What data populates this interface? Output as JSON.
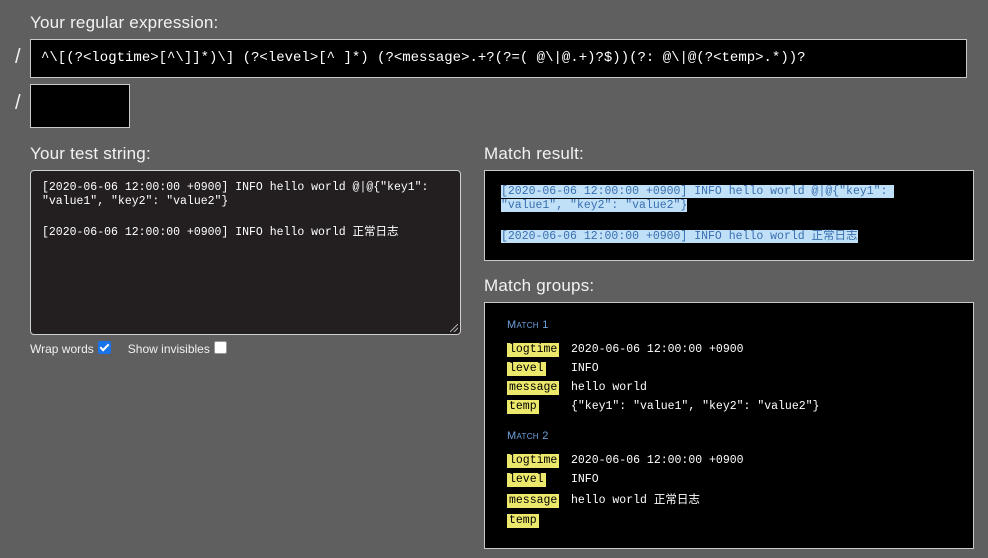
{
  "labels": {
    "regex_heading": "Your regular expression:",
    "test_heading": "Your test string:",
    "result_heading": "Match result:",
    "groups_heading": "Match groups:",
    "slash": "/"
  },
  "regex": {
    "value": "^\\[(?<logtime>[^\\]]*)\\] (?<level>[^ ]*) (?<message>.+?(?=( @\\|@.+)?$))(?: @\\|@(?<temp>.*))?",
    "flags": ""
  },
  "test_string": {
    "lines": [
      "[2020-06-06 12:00:00 +0900] INFO hello world @|@{\"key1\": \"value1\", \"key2\": \"value2\"}",
      "[2020-06-06 12:00:00 +0900] INFO hello world 正常日志"
    ]
  },
  "options": {
    "wrap_words": "Wrap words",
    "wrap_words_checked": true,
    "show_invisibles": "Show invisibles",
    "show_invisibles_checked": false
  },
  "result": {
    "lines": [
      "[2020-06-06 12:00:00 +0900] INFO hello world @|@{\"key1\": \"value1\", \"key2\": \"value2\"}",
      "[2020-06-06 12:00:00 +0900] INFO hello world 正常日志"
    ],
    "highlight_color": "#bfe0f7"
  },
  "matches": [
    {
      "title": "Match 1",
      "groups": [
        {
          "name": "logtime",
          "value": "2020-06-06 12:00:00 +0900"
        },
        {
          "name": "level",
          "value": "INFO"
        },
        {
          "name": "message",
          "value": "hello world"
        },
        {
          "name": "temp",
          "value": "{\"key1\": \"value1\", \"key2\": \"value2\"}"
        }
      ]
    },
    {
      "title": "Match 2",
      "groups": [
        {
          "name": "logtime",
          "value": "2020-06-06 12:00:00 +0900"
        },
        {
          "name": "level",
          "value": "INFO"
        },
        {
          "name": "message",
          "value": "hello world 正常日志"
        },
        {
          "name": "temp",
          "value": ""
        }
      ]
    }
  ],
  "colors": {
    "background": "#5f5f5f",
    "group_label": "#ece86c",
    "match_title": "#6fa2dc"
  }
}
